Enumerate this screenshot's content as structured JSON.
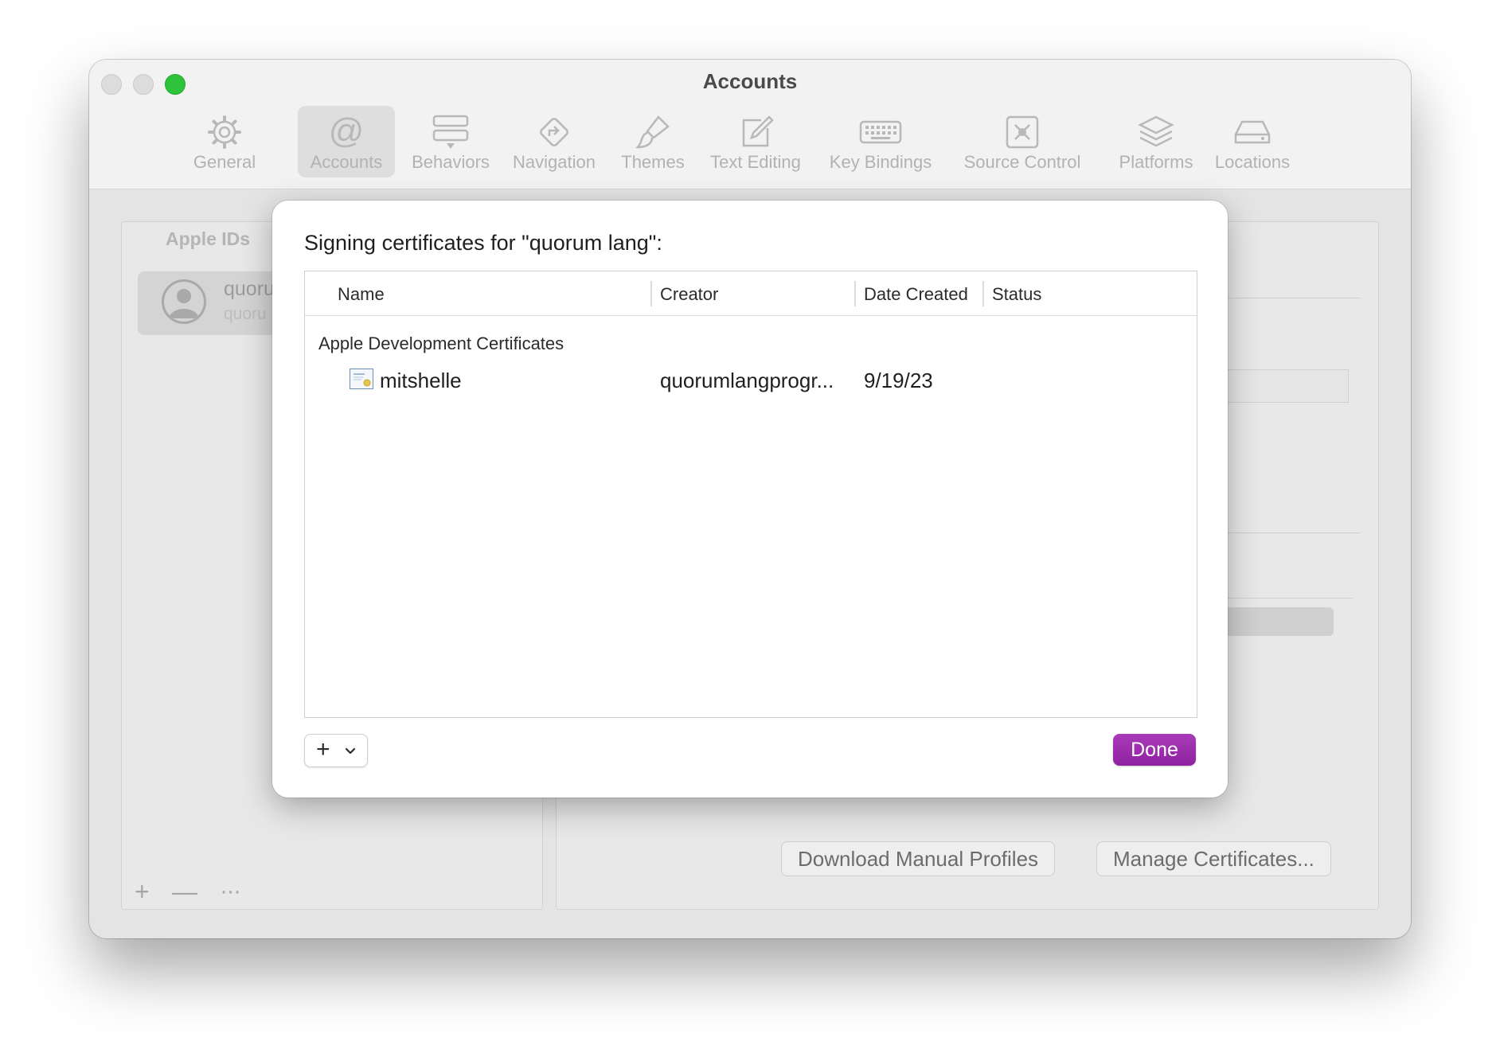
{
  "window": {
    "title": "Accounts"
  },
  "toolbar": {
    "items": [
      {
        "label": "General",
        "icon": "gear-icon"
      },
      {
        "label": "Accounts",
        "icon": "at-sign-icon",
        "selected": true
      },
      {
        "label": "Behaviors",
        "icon": "behaviors-icon"
      },
      {
        "label": "Navigation",
        "icon": "navigation-icon"
      },
      {
        "label": "Themes",
        "icon": "paintbrush-icon"
      },
      {
        "label": "Text Editing",
        "icon": "pencil-square-icon"
      },
      {
        "label": "Key Bindings",
        "icon": "keyboard-icon"
      },
      {
        "label": "Source Control",
        "icon": "source-control-icon"
      },
      {
        "label": "Platforms",
        "icon": "layers-icon"
      },
      {
        "label": "Locations",
        "icon": "drive-icon"
      }
    ]
  },
  "sidebar": {
    "header": "Apple IDs",
    "account": {
      "name": "quoru",
      "sub": "quoru"
    },
    "bottom": {
      "add": "+",
      "remove": "—",
      "more": "⋯"
    }
  },
  "detail": {
    "download_label": "Download Manual Profiles",
    "manage_label": "Manage Certificates..."
  },
  "sheet": {
    "title": "Signing certificates for \"quorum lang\":",
    "columns": [
      "Name",
      "Creator",
      "Date Created",
      "Status"
    ],
    "group": "Apple Development Certificates",
    "rows": [
      {
        "name": "mitshelle",
        "creator": "quorumlangprogr...",
        "date": "9/19/23",
        "status": ""
      }
    ],
    "add_label": "+",
    "done_label": "Done",
    "accent": "#9b2cae"
  }
}
